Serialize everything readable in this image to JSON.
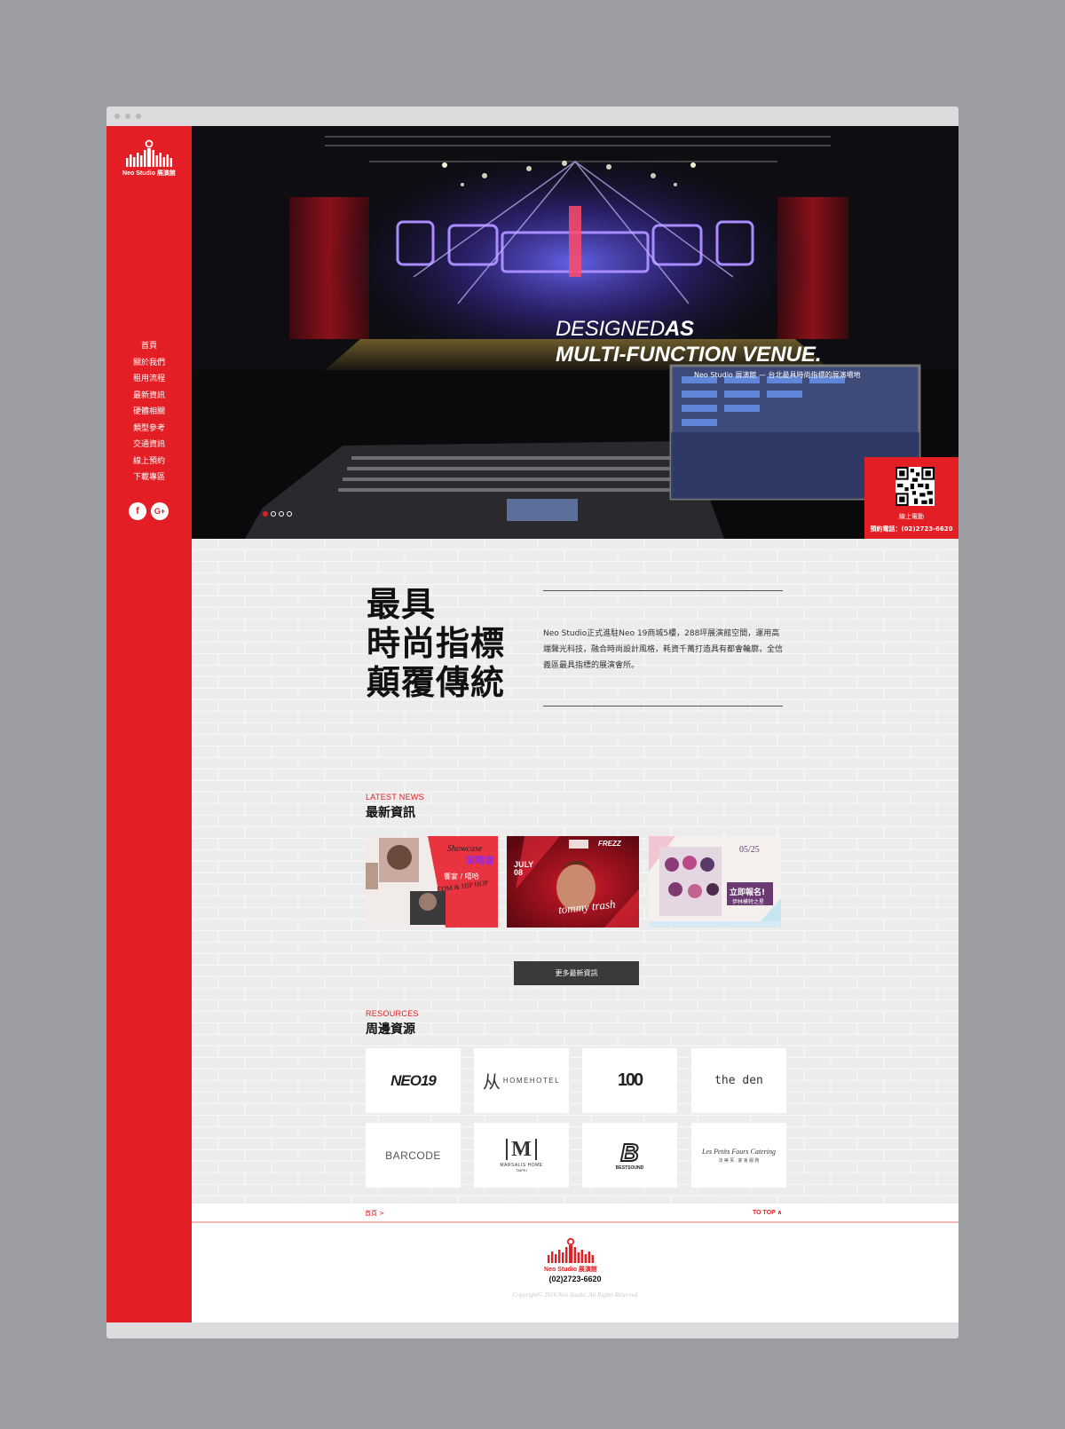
{
  "brand": {
    "name_en": "Neo Studio",
    "name_zh": "展演館",
    "accent": "#e31e24"
  },
  "nav": {
    "items": [
      "首頁",
      "關於我們",
      "租用流程",
      "最新資訊",
      "硬體相關",
      "類型參考",
      "交通資訊",
      "線上預約",
      "下載專區"
    ],
    "social": [
      "facebook-icon",
      "google-plus-icon"
    ],
    "social_glyphs": [
      "f",
      "G+"
    ]
  },
  "hero": {
    "line1_light": "DESIGNED",
    "line1_bold": "AS",
    "line2": "MULTI-FUNCTION VENUE.",
    "subtitle": "Neo Studio 展演館 — 台北最具時尚指標的展演場地",
    "qr_label": "線上電動",
    "qr_phone": "預約電話：(02)2723-6620"
  },
  "intro": {
    "slogan": [
      "最具",
      "時尚指標",
      "顛覆傳統"
    ],
    "text": "Neo Studio正式進駐Neo 19商城5樓，288坪展演館空間，運用高端聲光科技，融合時尚設計風格，耗資千萬打造具有都會輪廓，全信義區最具指標的展演會所。"
  },
  "news": {
    "label_en": "LATEST NEWS",
    "label_zh": "最新資訊",
    "cards": [
      {
        "title": "Showcase",
        "sub": "演唱會",
        "tag": "EDM & HIP HOP",
        "tag2": "饗宴 / 嘻哈"
      },
      {
        "title": "tommy trash",
        "date": "JULY 08",
        "partner": "FREZZ"
      },
      {
        "date": "05/25",
        "cta": "立即報名!",
        "cta_sub": "伊林模特之星"
      }
    ],
    "more_label": "更多最新資訊"
  },
  "resources": {
    "label_en": "RESOURCES",
    "label_zh": "周邊資源",
    "items": [
      {
        "name": "NEO19",
        "icon": "neo19-logo"
      },
      {
        "name": "HOMEHOTEL",
        "icon": "homehotel-logo"
      },
      {
        "name": "100",
        "icon": "100-logo"
      },
      {
        "name": "the den",
        "icon": "the-den-logo"
      },
      {
        "name": "BARCODE",
        "icon": "barcode-logo"
      },
      {
        "name": "MARSALIS HOME",
        "sub": "TAIPEI",
        "icon": "marsalis-logo"
      },
      {
        "name": "BESTSOUND",
        "icon": "bestsound-logo"
      },
      {
        "name": "Les Petits Fours Catering",
        "sub": "法 蒂 芙 . 宴 會 服 務",
        "icon": "les-petits-fours-logo"
      }
    ]
  },
  "footer": {
    "breadcrumb": "首頁 >",
    "to_top": "TO TOP ∧",
    "phone": "(02)2723-6620",
    "copyright": "Copyright© 2016 Neo Studio. All Rights Reserved"
  }
}
